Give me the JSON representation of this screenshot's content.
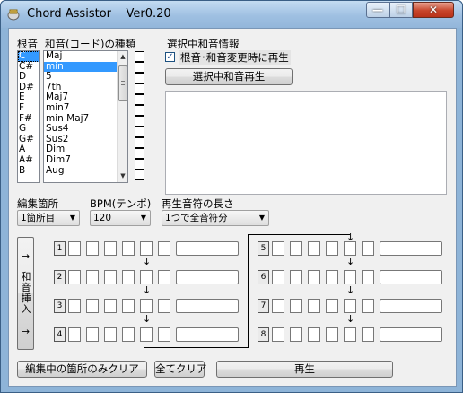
{
  "window": {
    "title": "Chord Assistor    Ver0.20",
    "min": "—",
    "max": "☐",
    "close": "✕"
  },
  "roots": {
    "header": "根音",
    "items": [
      "C",
      "C#",
      "D",
      "D#",
      "E",
      "F",
      "F#",
      "G",
      "G#",
      "A",
      "A#",
      "B"
    ],
    "selected": "C"
  },
  "chord_types": {
    "header": "和音(コード)の種類",
    "items": [
      "Maj",
      "min",
      "5",
      "7th",
      "Maj7",
      "min7",
      "min Maj7",
      "Sus4",
      "Sus2",
      "Dim",
      "Dim7",
      "Aug"
    ],
    "selected": "min"
  },
  "selected_info": {
    "header": "選択中和音情報",
    "auto_play_label": "根音･和音変更時に再生",
    "auto_play_checked": "✓",
    "play_button": "選択中和音再生"
  },
  "edit_location": {
    "label": "編集箇所",
    "value": "1箇所目"
  },
  "bpm": {
    "label": "BPM(テンポ)",
    "value": "120"
  },
  "note_length": {
    "label": "再生音符の長さ",
    "value": "1つで全音符分"
  },
  "insert_button": {
    "arrow_top": "→",
    "text": "和音挿入",
    "arrow_bottom": "→"
  },
  "slots": [
    "1",
    "2",
    "3",
    "4",
    "5",
    "6",
    "7",
    "8"
  ],
  "bottom": {
    "clear_current": "編集中の箇所のみクリア",
    "clear_all": "全てクリア",
    "play": "再生"
  }
}
